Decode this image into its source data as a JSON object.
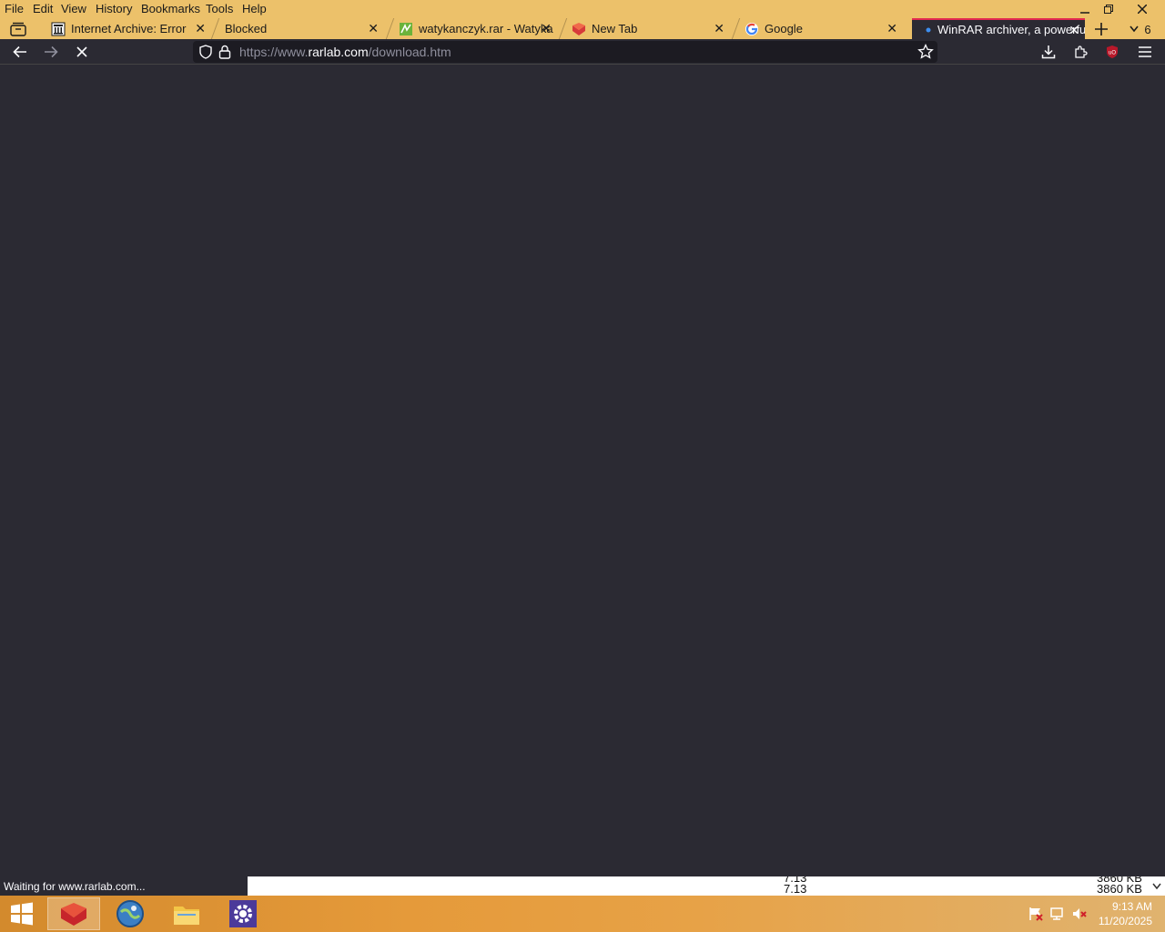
{
  "menu": {
    "items": [
      "File",
      "Edit",
      "View",
      "History",
      "Bookmarks",
      "Tools",
      "Help"
    ]
  },
  "tabs": [
    {
      "title": "Internet Archive: Error",
      "icon": "archive-icon"
    },
    {
      "title": "Blocked",
      "icon": ""
    },
    {
      "title": "watykanczyk.rar - Watyka",
      "icon": "site-icon"
    },
    {
      "title": "New Tab",
      "icon": "firefox-icon"
    },
    {
      "title": "Google",
      "icon": "google-icon"
    },
    {
      "title": "WinRAR archiver, a powerful",
      "icon": "loading-dot-icon",
      "active": true
    }
  ],
  "tab_overflow_count": "6",
  "url": {
    "prefix": "https://www.",
    "domain": "rarlab.com",
    "path": "/download.htm"
  },
  "status_text": "Waiting for www.rarlab.com...",
  "page_strip": {
    "version": "7.13",
    "size": "3860 KB",
    "ghost_version": "7.13",
    "ghost_size": "3860 KB"
  },
  "clock": {
    "time": "9:13 AM",
    "date": "11/20/2025"
  },
  "colors": {
    "frame": "#ecc16a",
    "toolbar": "#2b2a33",
    "urlbar": "#1c1b22",
    "active_tab_accent": "#e22850"
  }
}
